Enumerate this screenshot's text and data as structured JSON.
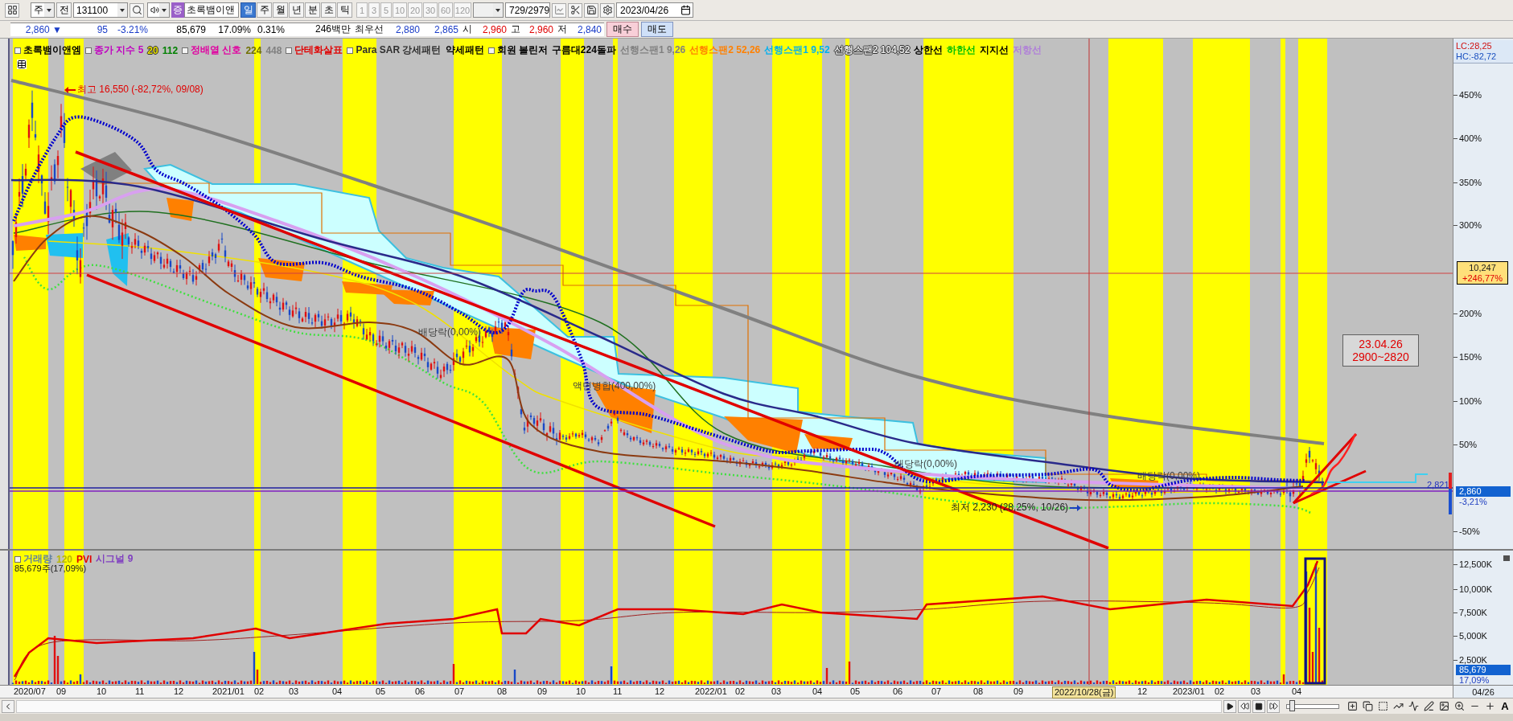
{
  "toolbar": {
    "period_unit": "주",
    "prefix": "전",
    "code": "131100",
    "badge": "증",
    "stock_name": "초록뱀이앤",
    "periods": [
      {
        "label": "일",
        "selected": true
      },
      {
        "label": "주",
        "selected": false
      },
      {
        "label": "월",
        "selected": false
      },
      {
        "label": "년",
        "selected": false
      },
      {
        "label": "분",
        "selected": false
      },
      {
        "label": "초",
        "selected": false
      },
      {
        "label": "틱",
        "selected": false
      }
    ],
    "intervals": [
      {
        "label": "1",
        "disabled": true
      },
      {
        "label": "3",
        "disabled": true
      },
      {
        "label": "5",
        "disabled": true
      },
      {
        "label": "10",
        "disabled": true
      },
      {
        "label": "20",
        "disabled": true
      },
      {
        "label": "30",
        "disabled": true
      },
      {
        "label": "60",
        "disabled": true
      },
      {
        "label": "120",
        "disabled": true
      }
    ],
    "count": "729/2979",
    "date": "2023/04/26"
  },
  "quote": {
    "items": [
      {
        "text": "2,860 ▼",
        "kind": "value",
        "color": "#1a3cc8"
      },
      {
        "text": "95",
        "kind": "value",
        "color": "#1a3cc8"
      },
      {
        "text": "-3.21%",
        "kind": "value",
        "color": "#1a3cc8"
      },
      {
        "text": "85,679",
        "kind": "value",
        "color": "#000000"
      },
      {
        "text": "17.09%",
        "kind": "value",
        "color": "#000000"
      },
      {
        "text": "0.31%",
        "kind": "value",
        "color": "#000000"
      },
      {
        "text": "246백만",
        "kind": "value",
        "color": "#000000"
      },
      {
        "text": "최우선",
        "kind": "label"
      },
      {
        "text": "2,880",
        "kind": "value",
        "color": "#1a3cc8"
      },
      {
        "text": "2,865",
        "kind": "value",
        "color": "#1a3cc8"
      },
      {
        "text": "시",
        "kind": "label"
      },
      {
        "text": "2,960",
        "kind": "value",
        "color": "#e00000"
      },
      {
        "text": "고",
        "kind": "label"
      },
      {
        "text": "2,960",
        "kind": "value",
        "color": "#e00000"
      },
      {
        "text": "저",
        "kind": "label"
      },
      {
        "text": "2,840",
        "kind": "value",
        "color": "#1a3cc8"
      }
    ],
    "buttons": [
      {
        "label": "매수",
        "kind": "buy"
      },
      {
        "label": "매도",
        "kind": "sell"
      }
    ]
  },
  "price_pane": {
    "legend": [
      {
        "text": "초록뱀이앤엠",
        "color": "#000000",
        "marker": true
      },
      {
        "text": "종가 지수 5",
        "color": "#c000c0",
        "marker": true
      },
      {
        "text": "20",
        "color": "#e8e000",
        "marker": false
      },
      {
        "text": "112",
        "color": "#008000",
        "marker": false
      },
      {
        "text": "정배열 신호",
        "color": "#e000a0",
        "marker": true
      },
      {
        "text": "224",
        "color": "#707000",
        "marker": false
      },
      {
        "text": "448",
        "color": "#808080",
        "marker": false
      },
      {
        "text": "단테화살표",
        "color": "#e00000",
        "marker": true
      },
      {
        "text": "Para SAR 강세패턴",
        "color": "#303030",
        "marker": true
      },
      {
        "text": "약세패턴",
        "color": "#000000",
        "marker": false
      },
      {
        "text": "회원 볼린저",
        "color": "#000000",
        "marker": true
      },
      {
        "text": "구름대224돌파",
        "color": "#000000",
        "marker": false
      },
      {
        "text": "선행스팬1 9,26",
        "color": "#808080",
        "marker": false
      },
      {
        "text": "선행스팬2 52,26",
        "color": "#ff8000",
        "marker": false
      },
      {
        "text": "선행스팬1 9,52",
        "color": "#00b0f0",
        "marker": false
      },
      {
        "text": "선행스팬2 104,52",
        "color": "#e8e8e8",
        "marker": false
      },
      {
        "text": "상한선",
        "color": "#000000",
        "marker": false
      },
      {
        "text": "하한선",
        "color": "#00c000",
        "marker": false
      },
      {
        "text": "지지선",
        "color": "#000000",
        "marker": false
      },
      {
        "text": "저항선",
        "color": "#b080d8",
        "marker": false
      }
    ],
    "annotations": [
      {
        "kind": "high",
        "text": "최고 16,550 (-82,72%, 09/08)"
      },
      {
        "kind": "event",
        "text": "배당락(0,00%)"
      },
      {
        "kind": "event",
        "text": "액면병합(400,00%)"
      },
      {
        "kind": "event",
        "text": "배당락(0,00%)"
      },
      {
        "kind": "event",
        "text": "배당락(0,00%)"
      },
      {
        "kind": "low",
        "text": "최저 2,230 (28,25%, 10/26)"
      }
    ],
    "note": [
      "23.04.26",
      "2900~2820"
    ],
    "level_label": "2,821",
    "axis": {
      "lc": "LC:28,25",
      "hc": "HC:-82,72",
      "ticks": [
        "450%",
        "400%",
        "350%",
        "300%",
        "200%",
        "150%",
        "100%",
        "50%",
        "-50%"
      ],
      "crosshair_price": "10,247",
      "crosshair_change": "+246,77%",
      "current_price": "2,860",
      "current_change": "-3,21%"
    }
  },
  "volume_pane": {
    "legend": [
      {
        "text": "거래량",
        "color": "#6080a0",
        "marker": true
      },
      {
        "text": "120",
        "color": "#b8b800",
        "marker": false
      },
      {
        "text": "PVI",
        "color": "#e00000",
        "marker": false
      },
      {
        "text": "시그널 9",
        "color": "#8040c0",
        "marker": false
      }
    ],
    "summary": "85,679주(17,09%)",
    "axis": {
      "ticks": [
        "12,500K",
        "10,000K",
        "7,500K",
        "5,000K",
        "2,500K"
      ],
      "current_volume": "85,679",
      "current_rate": "17,09%"
    }
  },
  "x_axis": {
    "labels": [
      {
        "text": "2020/07",
        "highlighted": false
      },
      {
        "text": "09",
        "highlighted": false
      },
      {
        "text": "10",
        "highlighted": false
      },
      {
        "text": "11",
        "highlighted": false
      },
      {
        "text": "12",
        "highlighted": false
      },
      {
        "text": "2021/01",
        "highlighted": false
      },
      {
        "text": "02",
        "highlighted": false
      },
      {
        "text": "03",
        "highlighted": false
      },
      {
        "text": "04",
        "highlighted": false
      },
      {
        "text": "05",
        "highlighted": false
      },
      {
        "text": "06",
        "highlighted": false
      },
      {
        "text": "07",
        "highlighted": false
      },
      {
        "text": "08",
        "highlighted": false
      },
      {
        "text": "09",
        "highlighted": false
      },
      {
        "text": "10",
        "highlighted": false
      },
      {
        "text": "11",
        "highlighted": false
      },
      {
        "text": "12",
        "highlighted": false
      },
      {
        "text": "2022/01",
        "highlighted": false
      },
      {
        "text": "02",
        "highlighted": false
      },
      {
        "text": "03",
        "highlighted": false
      },
      {
        "text": "04",
        "highlighted": false
      },
      {
        "text": "05",
        "highlighted": false
      },
      {
        "text": "06",
        "highlighted": false
      },
      {
        "text": "07",
        "highlighted": false
      },
      {
        "text": "08",
        "highlighted": false
      },
      {
        "text": "09",
        "highlighted": false
      },
      {
        "text": "2022/10/28(금)",
        "highlighted": true
      },
      {
        "text": "12",
        "highlighted": false
      },
      {
        "text": "2023/01",
        "highlighted": false
      },
      {
        "text": "02",
        "highlighted": false
      },
      {
        "text": "03",
        "highlighted": false
      },
      {
        "text": "04",
        "highlighted": false
      }
    ],
    "end_label": "04/26"
  },
  "scroll": {
    "zoom_slider": {
      "level": 0.1
    },
    "font_button": "A"
  }
}
